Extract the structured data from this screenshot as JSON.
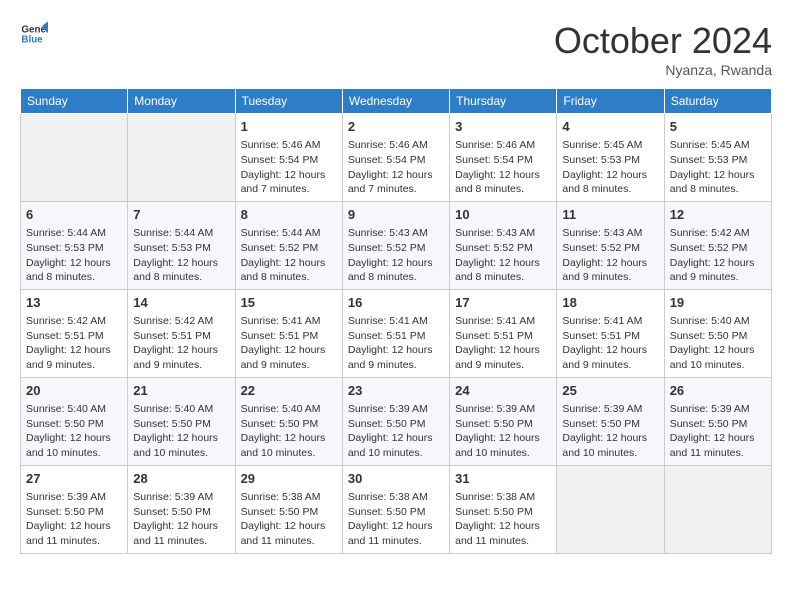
{
  "header": {
    "logo_line1": "General",
    "logo_line2": "Blue",
    "month": "October 2024",
    "location": "Nyanza, Rwanda"
  },
  "days_of_week": [
    "Sunday",
    "Monday",
    "Tuesday",
    "Wednesday",
    "Thursday",
    "Friday",
    "Saturday"
  ],
  "weeks": [
    [
      {
        "day": null
      },
      {
        "day": null
      },
      {
        "day": "1",
        "sunrise": "Sunrise: 5:46 AM",
        "sunset": "Sunset: 5:54 PM",
        "daylight": "Daylight: 12 hours and 7 minutes."
      },
      {
        "day": "2",
        "sunrise": "Sunrise: 5:46 AM",
        "sunset": "Sunset: 5:54 PM",
        "daylight": "Daylight: 12 hours and 7 minutes."
      },
      {
        "day": "3",
        "sunrise": "Sunrise: 5:46 AM",
        "sunset": "Sunset: 5:54 PM",
        "daylight": "Daylight: 12 hours and 8 minutes."
      },
      {
        "day": "4",
        "sunrise": "Sunrise: 5:45 AM",
        "sunset": "Sunset: 5:53 PM",
        "daylight": "Daylight: 12 hours and 8 minutes."
      },
      {
        "day": "5",
        "sunrise": "Sunrise: 5:45 AM",
        "sunset": "Sunset: 5:53 PM",
        "daylight": "Daylight: 12 hours and 8 minutes."
      }
    ],
    [
      {
        "day": "6",
        "sunrise": "Sunrise: 5:44 AM",
        "sunset": "Sunset: 5:53 PM",
        "daylight": "Daylight: 12 hours and 8 minutes."
      },
      {
        "day": "7",
        "sunrise": "Sunrise: 5:44 AM",
        "sunset": "Sunset: 5:53 PM",
        "daylight": "Daylight: 12 hours and 8 minutes."
      },
      {
        "day": "8",
        "sunrise": "Sunrise: 5:44 AM",
        "sunset": "Sunset: 5:52 PM",
        "daylight": "Daylight: 12 hours and 8 minutes."
      },
      {
        "day": "9",
        "sunrise": "Sunrise: 5:43 AM",
        "sunset": "Sunset: 5:52 PM",
        "daylight": "Daylight: 12 hours and 8 minutes."
      },
      {
        "day": "10",
        "sunrise": "Sunrise: 5:43 AM",
        "sunset": "Sunset: 5:52 PM",
        "daylight": "Daylight: 12 hours and 8 minutes."
      },
      {
        "day": "11",
        "sunrise": "Sunrise: 5:43 AM",
        "sunset": "Sunset: 5:52 PM",
        "daylight": "Daylight: 12 hours and 9 minutes."
      },
      {
        "day": "12",
        "sunrise": "Sunrise: 5:42 AM",
        "sunset": "Sunset: 5:52 PM",
        "daylight": "Daylight: 12 hours and 9 minutes."
      }
    ],
    [
      {
        "day": "13",
        "sunrise": "Sunrise: 5:42 AM",
        "sunset": "Sunset: 5:51 PM",
        "daylight": "Daylight: 12 hours and 9 minutes."
      },
      {
        "day": "14",
        "sunrise": "Sunrise: 5:42 AM",
        "sunset": "Sunset: 5:51 PM",
        "daylight": "Daylight: 12 hours and 9 minutes."
      },
      {
        "day": "15",
        "sunrise": "Sunrise: 5:41 AM",
        "sunset": "Sunset: 5:51 PM",
        "daylight": "Daylight: 12 hours and 9 minutes."
      },
      {
        "day": "16",
        "sunrise": "Sunrise: 5:41 AM",
        "sunset": "Sunset: 5:51 PM",
        "daylight": "Daylight: 12 hours and 9 minutes."
      },
      {
        "day": "17",
        "sunrise": "Sunrise: 5:41 AM",
        "sunset": "Sunset: 5:51 PM",
        "daylight": "Daylight: 12 hours and 9 minutes."
      },
      {
        "day": "18",
        "sunrise": "Sunrise: 5:41 AM",
        "sunset": "Sunset: 5:51 PM",
        "daylight": "Daylight: 12 hours and 9 minutes."
      },
      {
        "day": "19",
        "sunrise": "Sunrise: 5:40 AM",
        "sunset": "Sunset: 5:50 PM",
        "daylight": "Daylight: 12 hours and 10 minutes."
      }
    ],
    [
      {
        "day": "20",
        "sunrise": "Sunrise: 5:40 AM",
        "sunset": "Sunset: 5:50 PM",
        "daylight": "Daylight: 12 hours and 10 minutes."
      },
      {
        "day": "21",
        "sunrise": "Sunrise: 5:40 AM",
        "sunset": "Sunset: 5:50 PM",
        "daylight": "Daylight: 12 hours and 10 minutes."
      },
      {
        "day": "22",
        "sunrise": "Sunrise: 5:40 AM",
        "sunset": "Sunset: 5:50 PM",
        "daylight": "Daylight: 12 hours and 10 minutes."
      },
      {
        "day": "23",
        "sunrise": "Sunrise: 5:39 AM",
        "sunset": "Sunset: 5:50 PM",
        "daylight": "Daylight: 12 hours and 10 minutes."
      },
      {
        "day": "24",
        "sunrise": "Sunrise: 5:39 AM",
        "sunset": "Sunset: 5:50 PM",
        "daylight": "Daylight: 12 hours and 10 minutes."
      },
      {
        "day": "25",
        "sunrise": "Sunrise: 5:39 AM",
        "sunset": "Sunset: 5:50 PM",
        "daylight": "Daylight: 12 hours and 10 minutes."
      },
      {
        "day": "26",
        "sunrise": "Sunrise: 5:39 AM",
        "sunset": "Sunset: 5:50 PM",
        "daylight": "Daylight: 12 hours and 11 minutes."
      }
    ],
    [
      {
        "day": "27",
        "sunrise": "Sunrise: 5:39 AM",
        "sunset": "Sunset: 5:50 PM",
        "daylight": "Daylight: 12 hours and 11 minutes."
      },
      {
        "day": "28",
        "sunrise": "Sunrise: 5:39 AM",
        "sunset": "Sunset: 5:50 PM",
        "daylight": "Daylight: 12 hours and 11 minutes."
      },
      {
        "day": "29",
        "sunrise": "Sunrise: 5:38 AM",
        "sunset": "Sunset: 5:50 PM",
        "daylight": "Daylight: 12 hours and 11 minutes."
      },
      {
        "day": "30",
        "sunrise": "Sunrise: 5:38 AM",
        "sunset": "Sunset: 5:50 PM",
        "daylight": "Daylight: 12 hours and 11 minutes."
      },
      {
        "day": "31",
        "sunrise": "Sunrise: 5:38 AM",
        "sunset": "Sunset: 5:50 PM",
        "daylight": "Daylight: 12 hours and 11 minutes."
      },
      {
        "day": null
      },
      {
        "day": null
      }
    ]
  ]
}
